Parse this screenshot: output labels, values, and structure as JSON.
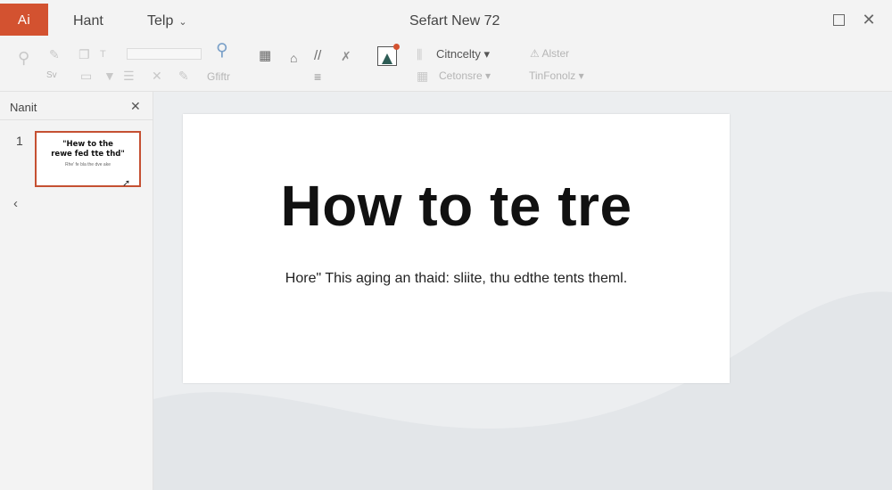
{
  "titlebar": {
    "app_label": "Ai",
    "menu": [
      "Hant",
      "Telp"
    ],
    "document_title": "Sefart New 72"
  },
  "ribbon": {
    "font_style_label": "Citncelty",
    "arrange_label": "Cetonsre",
    "alister_label": "Alster",
    "tinfonolz_label": "TinFonolz",
    "replace_label": "Gfiftr"
  },
  "pane": {
    "title": "Nanit",
    "slide_number": "1",
    "thumbnail_title": "\"Hew to the\nrewe fed tte thd\"",
    "thumbnail_subtitle": "Rhe' fe bla the dve ake"
  },
  "slide": {
    "title": "How to te tre",
    "subtitle": "Hore\" This aging an thaid: sliite, thu edthe tents theml."
  },
  "colors": {
    "accent": "#d35230",
    "thumb_border": "#c55032"
  }
}
